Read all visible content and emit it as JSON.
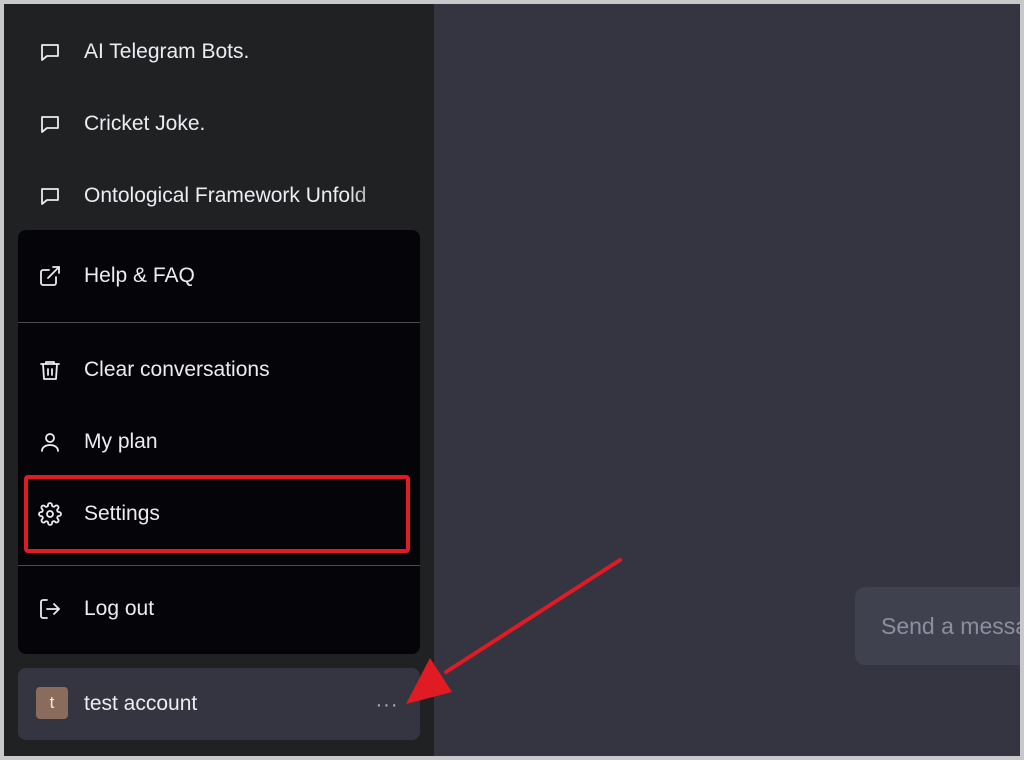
{
  "sidebar": {
    "conversations": [
      {
        "title": "AI Telegram Bots.",
        "icon": "chat-bubble-icon"
      },
      {
        "title": "Cricket Joke.",
        "icon": "chat-bubble-icon"
      },
      {
        "title": "Ontological Framework Unfold",
        "icon": "chat-bubble-icon"
      }
    ],
    "menu": {
      "items": [
        {
          "label": "Help & FAQ",
          "icon": "external-link-icon"
        },
        {
          "label": "Clear conversations",
          "icon": "trash-icon"
        },
        {
          "label": "My plan",
          "icon": "user-icon"
        },
        {
          "label": "Settings",
          "icon": "gear-icon",
          "highlighted": true
        },
        {
          "label": "Log out",
          "icon": "logout-icon"
        }
      ]
    },
    "account": {
      "avatar_initial": "t",
      "name": "test account",
      "more_label": "···"
    }
  },
  "main": {
    "input": {
      "placeholder": "Send a message."
    }
  },
  "annotation": {
    "color": "#e01b24"
  },
  "colors": {
    "sidebar_bg": "#202123",
    "main_bg": "#343541",
    "menu_bg": "#050509",
    "text": "#ececf1"
  }
}
